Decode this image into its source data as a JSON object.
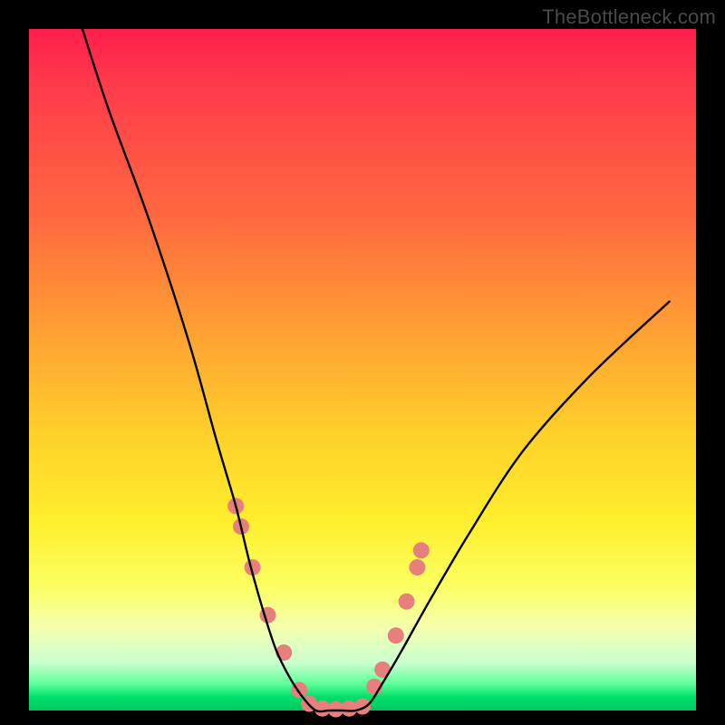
{
  "watermark": "TheBottleneck.com",
  "chart_data": {
    "type": "line",
    "title": "",
    "xlabel": "",
    "ylabel": "",
    "xlim": [
      0,
      100
    ],
    "ylim": [
      0,
      100
    ],
    "series": [
      {
        "name": "bottleneck-curve",
        "x": [
          8,
          12,
          18,
          24,
          28,
          31,
          33,
          35,
          37,
          39,
          41,
          43,
          45,
          47,
          49,
          51,
          53,
          56,
          60,
          66,
          74,
          84,
          96
        ],
        "values": [
          100,
          88,
          72,
          54,
          40,
          30,
          22,
          15,
          9,
          5,
          2,
          0,
          0,
          0,
          0,
          1,
          4,
          9,
          16,
          26,
          38,
          49,
          60
        ]
      }
    ],
    "markers": {
      "name": "highlight-dots",
      "x": [
        31.0,
        31.8,
        33.5,
        35.8,
        38.2,
        40.5,
        42.0,
        44.0,
        46.0,
        48.0,
        50.0,
        51.8,
        53.0,
        55.0,
        56.6,
        58.2,
        58.8
      ],
      "y": [
        30.0,
        27.0,
        21.0,
        14.0,
        8.5,
        3.0,
        1.0,
        0.3,
        0.2,
        0.3,
        0.6,
        3.5,
        6.0,
        11.0,
        16.0,
        21.0,
        23.5
      ],
      "color": "#e77f7d",
      "radius": 9
    },
    "curve_color": "#000000",
    "background_gradient": [
      "#ff1e4b",
      "#ffa233",
      "#ffee2c",
      "#00c95f"
    ]
  }
}
